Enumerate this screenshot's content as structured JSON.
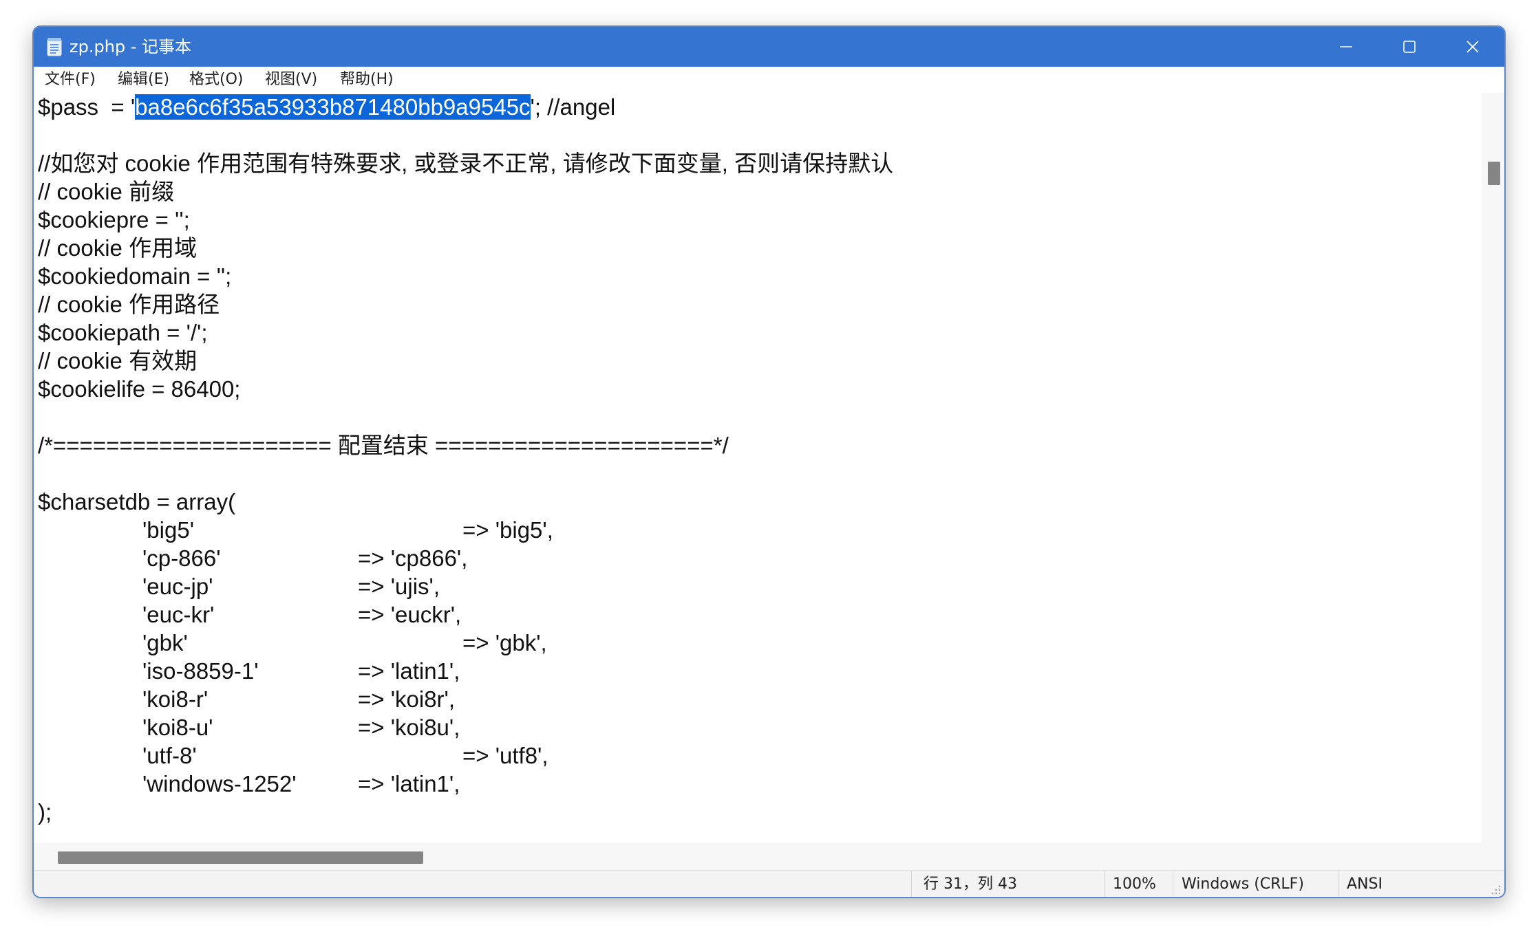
{
  "window": {
    "title": "zp.php - 记事本",
    "app_icon": "notepad-icon",
    "controls": {
      "minimize_icon": "minimize-icon",
      "maximize_icon": "maximize-icon",
      "close_icon": "close-icon"
    }
  },
  "menubar": {
    "items": [
      {
        "label": "文件(F)"
      },
      {
        "label": "编辑(E)"
      },
      {
        "label": "格式(O)"
      },
      {
        "label": "视图(V)"
      },
      {
        "label": "帮助(H)"
      }
    ]
  },
  "editor": {
    "line_pass": {
      "prefix": "$pass  = '",
      "selected": "ba8e6c6f35a53933b871480bb9a9545c",
      "suffix": "'; //angel"
    },
    "lines": [
      "//如您对 cookie 作用范围有特殊要求, 或登录不正常, 请修改下面变量, 否则请保持默认",
      "// cookie 前缀",
      "$cookiepre = '';",
      "// cookie 作用域",
      "$cookiedomain = '';",
      "// cookie 作用路径",
      "$cookiepath = '/';",
      "// cookie 有效期",
      "$cookielife = 86400;",
      "/*===================== 配置结束 =====================*/",
      "$charsetdb = array("
    ],
    "charsets": [
      {
        "key": "'big5'",
        "value": "=> 'big5',"
      },
      {
        "key": "'cp-866'",
        "value": "=> 'cp866',"
      },
      {
        "key": "'euc-jp'",
        "value": "=> 'ujis',"
      },
      {
        "key": "'euc-kr'",
        "value": "=> 'euckr',"
      },
      {
        "key": "'gbk'",
        "value": "=> 'gbk',"
      },
      {
        "key": "'iso-8859-1'",
        "value": "=> 'latin1',"
      },
      {
        "key": "'koi8-r'",
        "value": "=> 'koi8r',"
      },
      {
        "key": "'koi8-u'",
        "value": "=> 'koi8u',"
      },
      {
        "key": "'utf-8'",
        "value": "=> 'utf8',"
      },
      {
        "key": "'windows-1252'",
        "value": "=> 'latin1',"
      }
    ],
    "closing": ");"
  },
  "statusbar": {
    "position": "行 31，列 43",
    "zoom": "100%",
    "line_ending": "Windows (CRLF)",
    "encoding": "ANSI"
  },
  "colors": {
    "titlebar": "#3575d1",
    "selection": "#0a66d9"
  }
}
